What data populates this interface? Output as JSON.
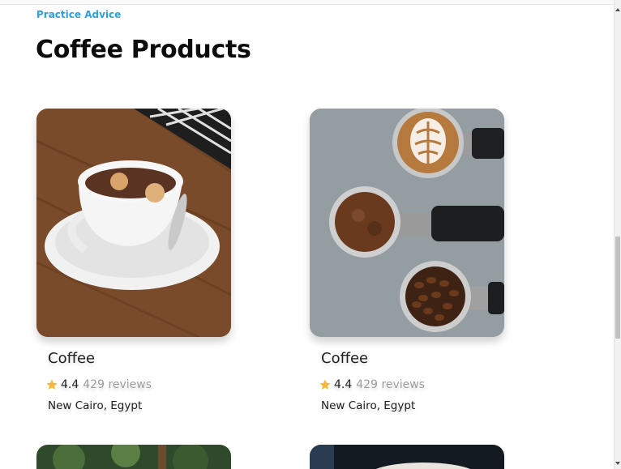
{
  "header": {
    "eyebrow": "Practice Advice",
    "title": "Coffee Products"
  },
  "products": [
    {
      "name": "Coffee",
      "rating": "4.4",
      "reviews": "429 reviews",
      "location": "New Cairo, Egypt",
      "image": "latte-cup-on-wooden-table"
    },
    {
      "name": "Coffee",
      "rating": "4.4",
      "reviews": "429 reviews",
      "location": "New Cairo, Egypt",
      "image": "portafilters-with-latte-art-grounds-and-beans"
    }
  ],
  "colors": {
    "eyebrow": "#2e9fd8",
    "star": "#f5b83d",
    "reviews_text": "#9e9e9e"
  },
  "icons": [
    "star-icon",
    "scroll-up-arrow-icon",
    "scroll-down-arrow-icon"
  ]
}
